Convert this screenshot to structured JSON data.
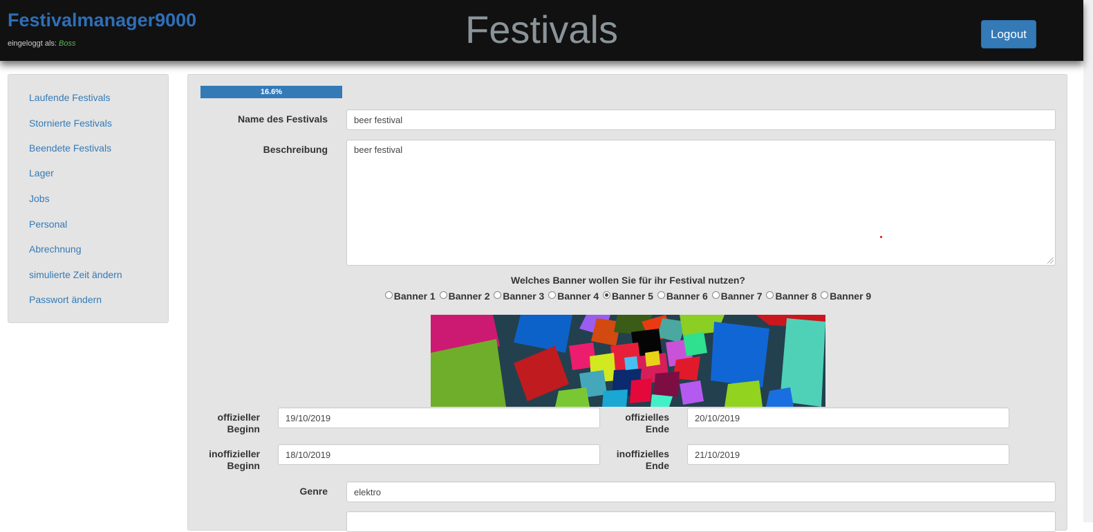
{
  "header": {
    "brand": "Festivalmanager9000",
    "login_prefix": "eingeloggt als:",
    "login_user": "Boss",
    "title": "Festivals",
    "logout_label": "Logout"
  },
  "sidebar": {
    "items": [
      {
        "label": "Laufende Festivals"
      },
      {
        "label": "Stornierte Festivals"
      },
      {
        "label": "Beendete Festivals"
      },
      {
        "label": "Lager"
      },
      {
        "label": "Jobs"
      },
      {
        "label": "Personal"
      },
      {
        "label": "Abrechnung"
      },
      {
        "label": "simulierte Zeit ändern"
      },
      {
        "label": "Passwort ändern"
      }
    ]
  },
  "form": {
    "progress": {
      "value": 16.6,
      "label": "16.6%"
    },
    "name": {
      "label": "Name des Festivals",
      "value": "beer festival"
    },
    "description": {
      "label": "Beschreibung",
      "value": "beer festival"
    },
    "banner": {
      "question": "Welches Banner wollen Sie für ihr Festival nutzen?",
      "options": [
        "Banner 1",
        "Banner 2",
        "Banner 3",
        "Banner 4",
        "Banner 5",
        "Banner 6",
        "Banner 7",
        "Banner 8",
        "Banner 9"
      ],
      "selected": "Banner 5"
    },
    "official_start": {
      "label_line1": "offizieller",
      "label_line2": "Beginn",
      "value": "19/10/2019"
    },
    "official_end": {
      "label_line1": "offizielles",
      "label_line2": "Ende",
      "value": "20/10/2019"
    },
    "unofficial_start": {
      "label_line1": "inoffizieller",
      "label_line2": "Beginn",
      "value": "18/10/2019"
    },
    "unofficial_end": {
      "label_line1": "inoffizielles",
      "label_line2": "Ende",
      "value": "21/10/2019"
    },
    "genre": {
      "label": "Genre",
      "value": "elektro"
    }
  },
  "colors": {
    "header_bg": "#111111",
    "brand": "#2e6fb7",
    "accent": "#337ab7",
    "panel_bg": "#e4e4e4",
    "user_green": "#5cb85c"
  }
}
